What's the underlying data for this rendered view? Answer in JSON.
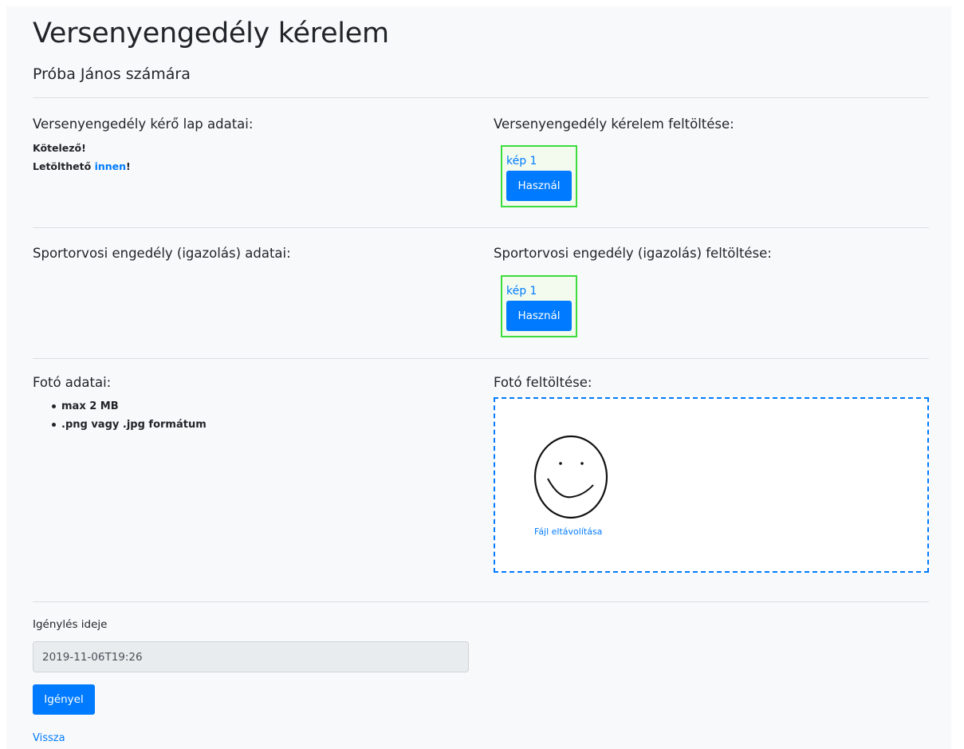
{
  "header": {
    "title": "Versenyengedély kérelem",
    "subtitle": "Próba János számára"
  },
  "license_section": {
    "heading": "Versenyengedély kérő lap adatai:",
    "required_text": "Kötelező!",
    "download_prefix": "Letölthető ",
    "download_link": "innen",
    "download_suffix": "!",
    "upload_heading": "Versenyengedély kérelem feltöltése:",
    "image_link": "kép 1",
    "use_button": "Használ"
  },
  "medical_section": {
    "heading": "Sportorvosi engedély (igazolás) adatai:",
    "upload_heading": "Sportorvosi engedély (igazolás) feltöltése:",
    "image_link": "kép 1",
    "use_button": "Használ"
  },
  "photo_section": {
    "heading": "Fotó adatai:",
    "requirements": [
      "max 2 MB",
      ".png vagy .jpg formátum"
    ],
    "upload_heading": "Fotó feltöltése:",
    "remove_file": "Fájl eltávolítása",
    "preview_icon": "smiley-face-icon"
  },
  "form": {
    "date_label": "Igénylés ideje",
    "date_value": "2019-11-06T19:26",
    "submit_button": "Igényel",
    "back_link": "Vissza"
  },
  "colors": {
    "primary": "#007bff",
    "thumb_border": "#3ddc3d",
    "page_bg": "#f8f9fa"
  }
}
